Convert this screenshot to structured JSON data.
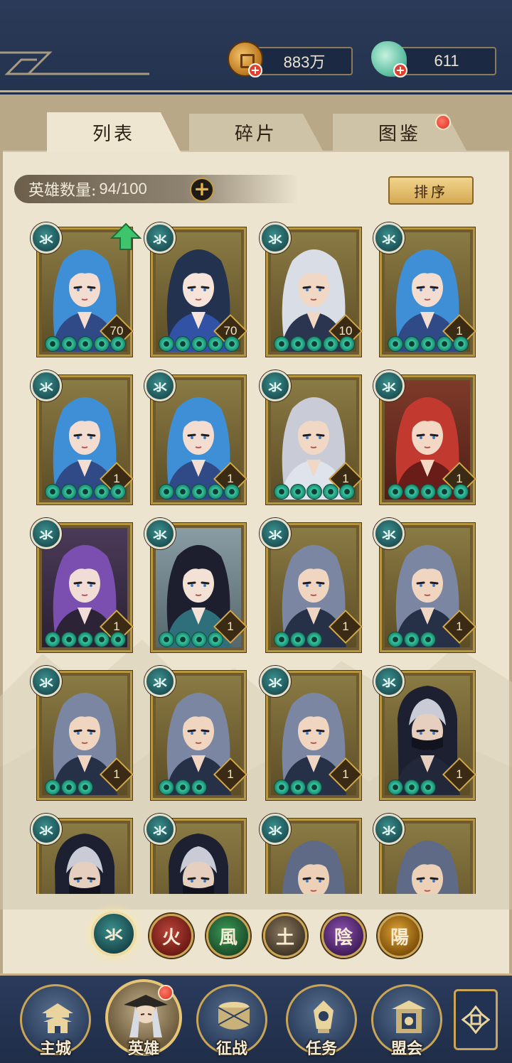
{
  "currencies": {
    "coins": "883万",
    "jade": "611"
  },
  "tabs": {
    "list": "列表",
    "fragments": "碎片",
    "codex": "图鉴"
  },
  "hero_count": {
    "label": "英雄数量:",
    "value": "94/100"
  },
  "sort_label": "排序",
  "heroes": [
    {
      "element": "氺",
      "level": "70",
      "stars": 5,
      "look": "blue-hair-woman",
      "upgrade": true
    },
    {
      "element": "氺",
      "level": "70",
      "stars": 5,
      "look": "opera-woman"
    },
    {
      "element": "氺",
      "level": "10",
      "stars": 5,
      "look": "white-hair-armored-man"
    },
    {
      "element": "氺",
      "level": "1",
      "stars": 5,
      "look": "blue-hair-woman"
    },
    {
      "element": "氺",
      "level": "1",
      "stars": 5,
      "look": "blue-hair-woman"
    },
    {
      "element": "氺",
      "level": "1",
      "stars": 5,
      "look": "blue-hair-woman"
    },
    {
      "element": "氺",
      "level": "1",
      "stars": 5,
      "look": "silver-hair-man"
    },
    {
      "element": "氺",
      "level": "1",
      "stars": 5,
      "look": "red-hair-woman"
    },
    {
      "element": "氺",
      "level": "1",
      "stars": 5,
      "look": "purple-hair-woman"
    },
    {
      "element": "氺",
      "level": "1",
      "stars": 4,
      "look": "black-hair-flower-woman"
    },
    {
      "element": "氺",
      "level": "1",
      "stars": 3,
      "look": "gray-hair-swordsman"
    },
    {
      "element": "氺",
      "level": "1",
      "stars": 3,
      "look": "gray-hair-swordsman"
    },
    {
      "element": "氺",
      "level": "1",
      "stars": 3,
      "look": "gray-hair-swordsman"
    },
    {
      "element": "氺",
      "level": "1",
      "stars": 3,
      "look": "gray-hair-swordsman"
    },
    {
      "element": "氺",
      "level": "1",
      "stars": 3,
      "look": "gray-hair-swordsman"
    },
    {
      "element": "氺",
      "level": "1",
      "stars": 3,
      "look": "hooded-assassin"
    },
    {
      "element": "氺",
      "level": "",
      "stars": 0,
      "look": "hooded-assassin"
    },
    {
      "element": "氺",
      "level": "",
      "stars": 0,
      "look": "hooded-assassin"
    },
    {
      "element": "氺",
      "level": "",
      "stars": 0,
      "look": "gray-hair-brute"
    },
    {
      "element": "氺",
      "level": "",
      "stars": 0,
      "look": "gray-hair-brute"
    }
  ],
  "element_filters": [
    {
      "label": "氺",
      "selected": true
    },
    {
      "label": "火",
      "selected": false
    },
    {
      "label": "風",
      "selected": false
    },
    {
      "label": "土",
      "selected": false
    },
    {
      "label": "陰",
      "selected": false
    },
    {
      "label": "陽",
      "selected": false
    }
  ],
  "nav": {
    "main_city": "主城",
    "heroes": "英雄",
    "campaign": "征战",
    "tasks": "任务",
    "alliance": "盟会"
  },
  "colors": {
    "hair_blue": "#3f8fd6",
    "hair_gray": "#7b86a3",
    "hair_white": "#d9dde6",
    "hair_red": "#c2392f",
    "hair_purple": "#7b4fb0",
    "hair_black": "#1d1f2e"
  }
}
